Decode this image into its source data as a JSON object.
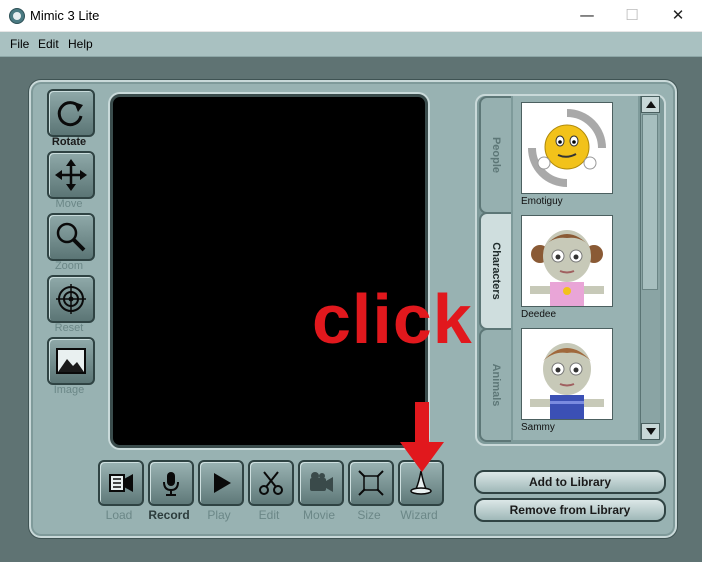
{
  "window": {
    "title": "Mimic 3 Lite",
    "minimize": "—",
    "maximize": "☐",
    "close": "✕"
  },
  "menu": [
    "File",
    "Edit",
    "Help"
  ],
  "toolbar": {
    "rotate": "Rotate",
    "move": "Move",
    "zoom": "Zoom",
    "reset": "Reset",
    "image": "Image"
  },
  "bottom_toolbar": {
    "load": "Load",
    "record": "Record",
    "play": "Play",
    "edit": "Edit",
    "movie": "Movie",
    "size": "Size",
    "wizard": "Wizard"
  },
  "library": {
    "tabs": [
      "People",
      "Characters",
      "Animals"
    ],
    "active_tab": "Characters",
    "items": [
      {
        "name": "Emotiguy"
      },
      {
        "name": "Deedee"
      },
      {
        "name": "Sammy"
      }
    ],
    "add_button": "Add to Library",
    "remove_button": "Remove from Library"
  },
  "annotation": {
    "text": "click",
    "color": "#e1181d"
  },
  "colors": {
    "panel": "#98b2b2",
    "background": "#5f7373",
    "menubar": "#a9c1c1"
  }
}
